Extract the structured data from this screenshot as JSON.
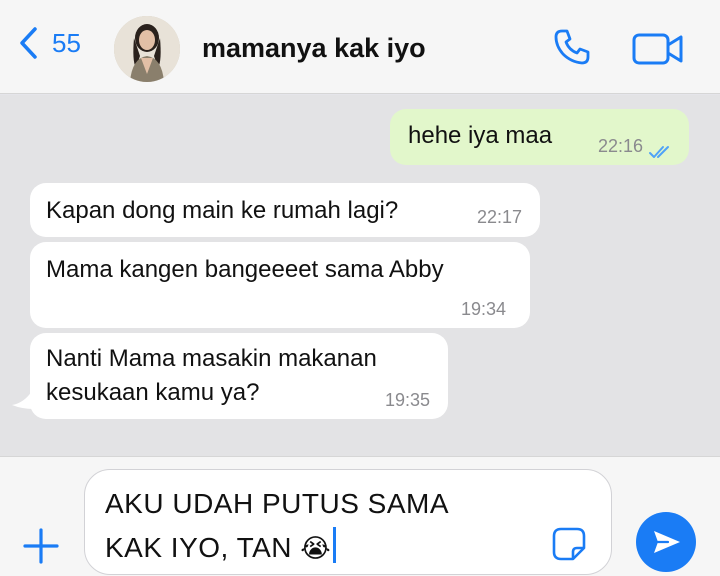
{
  "header": {
    "back_count": "55",
    "contact_name": "mamanya kak iyo"
  },
  "messages": [
    {
      "direction": "outgoing",
      "text": "hehe iya maa",
      "time": "22:16",
      "status": "read"
    },
    {
      "direction": "incoming",
      "text": "Kapan dong main ke rumah lagi?",
      "time": "22:17"
    },
    {
      "direction": "incoming",
      "text": "Mama kangen bangeeeet sama Abby",
      "time": "19:34"
    },
    {
      "direction": "incoming",
      "line1": "Nanti Mama masakin makanan",
      "line2": "kesukaan kamu ya?",
      "time": "19:35"
    }
  ],
  "composer": {
    "line1": "AKU UDAH PUTUS SAMA",
    "line2": "KAK IYO, TAN",
    "emoji": "😭"
  },
  "colors": {
    "accent": "#1a7cf5",
    "outgoing_bubble": "#e2f7cb",
    "incoming_bubble": "#ffffff",
    "read_ticks": "#4fa3f7"
  },
  "icons": [
    "chevron-left-icon",
    "avatar",
    "phone-icon",
    "video-camera-icon",
    "plus-icon",
    "sticker-icon",
    "send-icon",
    "double-check-icon"
  ]
}
